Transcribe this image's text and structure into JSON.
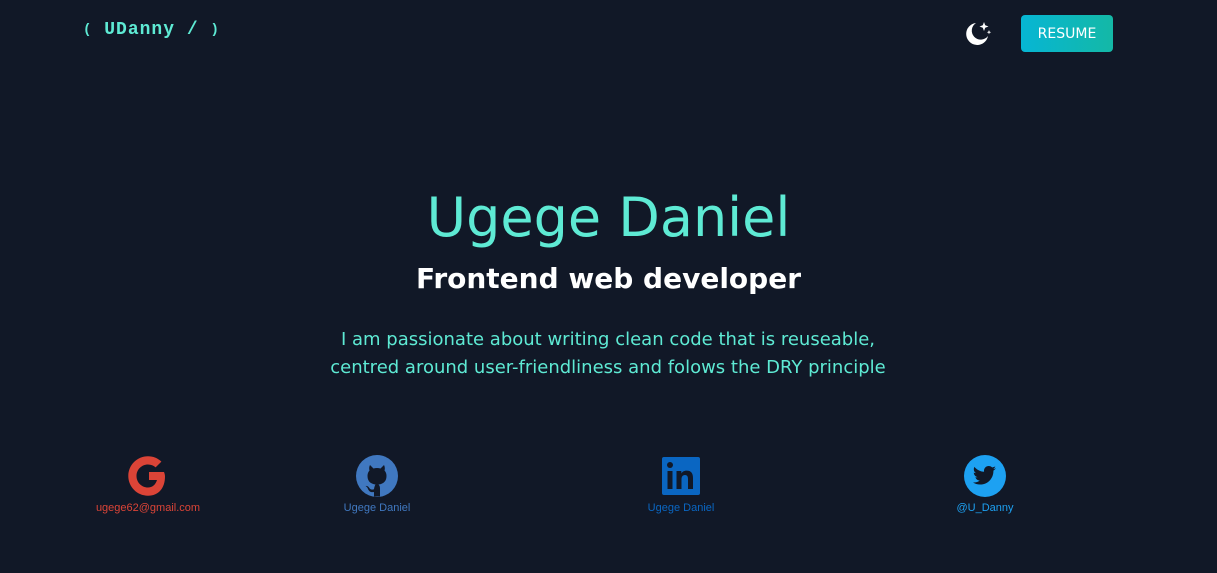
{
  "header": {
    "logo_open": "(",
    "logo_text": "UDanny /",
    "logo_close": ")",
    "theme_icon": "moon-star-icon",
    "resume_label": "RESUME"
  },
  "hero": {
    "name": "Ugege Daniel",
    "role": "Frontend web developer",
    "bio_line1": "I am passionate about writing clean code that is reuseable,",
    "bio_line2": "centred around user-friendliness and folows the DRY principle"
  },
  "socials": [
    {
      "icon": "google-icon",
      "label": "ugege62@gmail.com",
      "color": "#db4437"
    },
    {
      "icon": "github-icon",
      "label": "Ugege Daniel",
      "color": "#4078c0"
    },
    {
      "icon": "linkedin-icon",
      "label": "Ugege Daniel",
      "color": "#0a66c2"
    },
    {
      "icon": "twitter-icon",
      "label": "@U_Danny",
      "color": "#1da1f2"
    }
  ],
  "colors": {
    "background": "#111827",
    "accent": "#5eead4",
    "button_gradient_start": "#06b6d4",
    "button_gradient_end": "#14b8a6"
  }
}
